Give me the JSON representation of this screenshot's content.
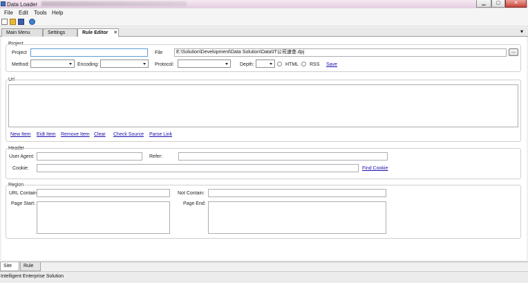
{
  "window": {
    "title": "Data Loader",
    "min_label": "▁",
    "max_label": "▢",
    "close_label": "✕"
  },
  "menu": [
    "File",
    "Edit",
    "Tools",
    "Help"
  ],
  "toolbar": {
    "icons": [
      "new-document-icon",
      "open-folder-icon",
      "save-icon",
      "help-icon"
    ]
  },
  "tabs": [
    {
      "label": "Main Menu"
    },
    {
      "label": "Settings"
    },
    {
      "label": "Rule Editor"
    }
  ],
  "tab_close": "✕",
  "tab_overflow": "▾",
  "project": {
    "group": "Project",
    "project_label": "Project",
    "project_value": "",
    "file_label": "File",
    "file_value": "E:\\Solution\\Development\\Data Solution\\Data\\IT公司速查.dpj",
    "browse_label": "...",
    "method_label": "Method:",
    "encoding_label": "Encoding:",
    "protocol_label": "Protocol:",
    "depth_label": "Depth:",
    "html_label": "HTML",
    "rss_label": "RSS",
    "save_label": "Save"
  },
  "url": {
    "group": "Url",
    "new_item": "New Item",
    "edit_item": "Eidt Item",
    "remove_item": "Remove Item",
    "clear": "Clear",
    "check_source": "Check Source",
    "parse_link": "Parse Link"
  },
  "header": {
    "group": "Header",
    "user_agent_label": "User Agent:",
    "refer_label": "Refer:",
    "cookie_label": "Cookie:",
    "find_cookie": "Find Cookie"
  },
  "region": {
    "group": "Region",
    "url_contain_label": "URL Contain:",
    "not_contain_label": "Not Contain:",
    "page_start_label": "Page Start:",
    "page_end_label": "Page End:"
  },
  "bottom_tabs": [
    "Site",
    "Rule"
  ],
  "status": "Intelligent Enterprise Solution"
}
